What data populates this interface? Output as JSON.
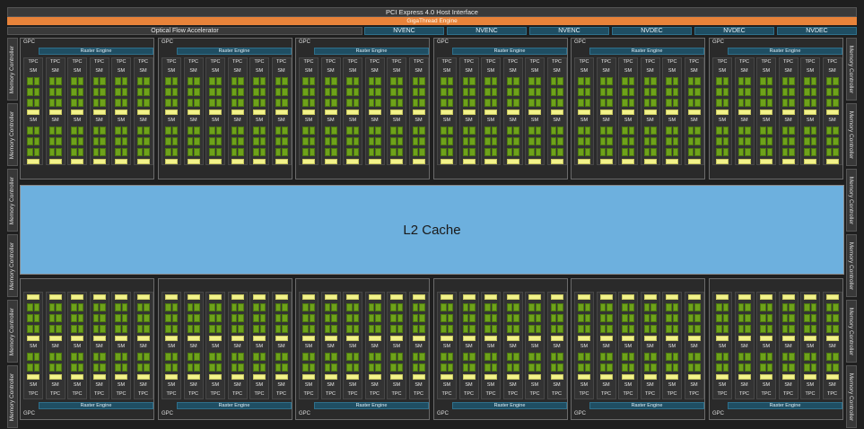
{
  "header": {
    "pcie": "PCI Express 4.0 Host Interface",
    "gigathread": "GigaThread Engine",
    "ofa": "Optical Flow Accelerator",
    "codecs": [
      "NVENC",
      "NVENC",
      "NVENC",
      "NVDEC",
      "NVDEC",
      "NVDEC"
    ]
  },
  "l2_cache": "L2 Cache",
  "memory_controller": "Memory Controller",
  "gpc": {
    "label": "GPC",
    "raster_engine": "Raster Engine",
    "tpc_label": "TPC",
    "sm_label": "SM",
    "count_per_row": 6,
    "tpcs_per_gpc": 6,
    "sms_per_tpc": 2
  },
  "colors": {
    "accent_orange": "#e8833a",
    "codec_teal": "#1f4e63",
    "l2_blue": "#6db0de",
    "core_green": "#6ea21a",
    "texture_yellow": "#f2f28a"
  }
}
